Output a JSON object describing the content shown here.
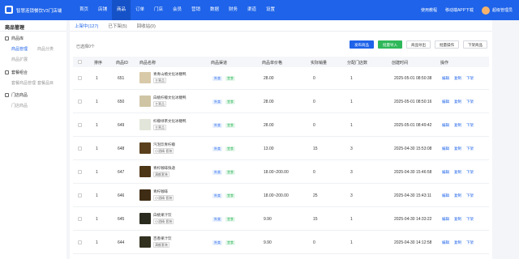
{
  "topbar": {
    "brand": "智慧连锁餐饮V3门店端",
    "nav": [
      "首页",
      "店铺",
      "商品",
      "订单",
      "门店",
      "会员",
      "营销",
      "数据",
      "财务",
      "渠道",
      "设置"
    ],
    "active_index": 2,
    "help": "使用教程",
    "app_download": "移动端APP下载",
    "user": "超级管理员"
  },
  "sidebar": {
    "title": "商品管理",
    "groups": [
      {
        "label": "商品库",
        "items": [
          "商品管理",
          "商品分类",
          "商品扩展"
        ]
      },
      {
        "label": "套餐组合",
        "items": [
          "套餐商品管理",
          "套餐品目"
        ]
      },
      {
        "label": "门店商品",
        "items": [
          "门店商品"
        ]
      }
    ]
  },
  "tabs": [
    "上架中(127)",
    "已下架(5)",
    "回收站(0)"
  ],
  "toolbar": {
    "selected": "已选择0个",
    "buttons": [
      "发布商品",
      "批量导入",
      "商品导出",
      "批量操作",
      "下架商品"
    ]
  },
  "table": {
    "headers": [
      "排序",
      "商品ID",
      "商品名称",
      "商品渠道",
      "商品单价格",
      "实际销量",
      "分配门店数",
      "创建时间",
      "操作"
    ],
    "rows": [
      {
        "sort": "1",
        "id": "651",
        "name": "青青山楂文化冰糖鸭",
        "tag": "主营品",
        "channel": [
          "外卖",
          "堂食"
        ],
        "price": "28.00",
        "sales": "0",
        "stores": "1",
        "time": "2025-05-01 08:50:38",
        "thumb": "#d8c9a8"
      },
      {
        "sort": "1",
        "id": "650",
        "name": "白桃柠檬文化冰糖鸭",
        "tag": "主营品",
        "channel": [
          "外卖",
          "堂食"
        ],
        "price": "28.00",
        "sales": "0",
        "stores": "1",
        "time": "2025-05-01 08:50:16",
        "thumb": "#cfc5a4"
      },
      {
        "sort": "1",
        "id": "649",
        "name": "柠檬绿茶文化冰糖鸭",
        "tag": "主营品",
        "channel": [
          "外卖",
          "堂食"
        ],
        "price": "28.00",
        "sales": "0",
        "stores": "1",
        "time": "2025-05-01 08:49:42",
        "thumb": "#e2e6da"
      },
      {
        "sort": "1",
        "id": "648",
        "name": "汽泡饮青柠檬",
        "tag": "小酒精·套装",
        "channel": [
          "外卖",
          "堂食"
        ],
        "price": "13.00",
        "sales": "15",
        "stores": "3",
        "time": "2025-04-30 15:53:08",
        "thumb": "#5a3f1c"
      },
      {
        "sort": "1",
        "id": "647",
        "name": "青柠咖啡快递",
        "tag": "满额套装",
        "channel": [
          "外卖",
          "堂食"
        ],
        "price": "18.00~200.00",
        "sales": "0",
        "stores": "3",
        "time": "2025-04-30 15:46:58",
        "thumb": "#4d3616"
      },
      {
        "sort": "1",
        "id": "646",
        "name": "青柠咖啡",
        "tag": "小酒精·套装",
        "channel": [
          "外卖",
          "堂食"
        ],
        "price": "18.00~200.00",
        "sales": "25",
        "stores": "3",
        "time": "2025-04-30 15:43:11",
        "thumb": "#3e2c14"
      },
      {
        "sort": "1",
        "id": "645",
        "name": "白桃果汁饮",
        "tag": "小酒精·套装",
        "channel": [
          "外卖",
          "堂食"
        ],
        "price": "9.90",
        "sales": "15",
        "stores": "1",
        "time": "2025-04-30 14:33:22",
        "thumb": "#2a2a1e"
      },
      {
        "sort": "1",
        "id": "644",
        "name": "百香果汁饮",
        "tag": "满额套装",
        "channel": [
          "外卖",
          "堂食"
        ],
        "price": "9.90",
        "sales": "0",
        "stores": "1",
        "time": "2025-04-30 14:12:58",
        "thumb": "#32301f"
      }
    ],
    "actions": [
      "编辑",
      "复制",
      "下架"
    ]
  }
}
